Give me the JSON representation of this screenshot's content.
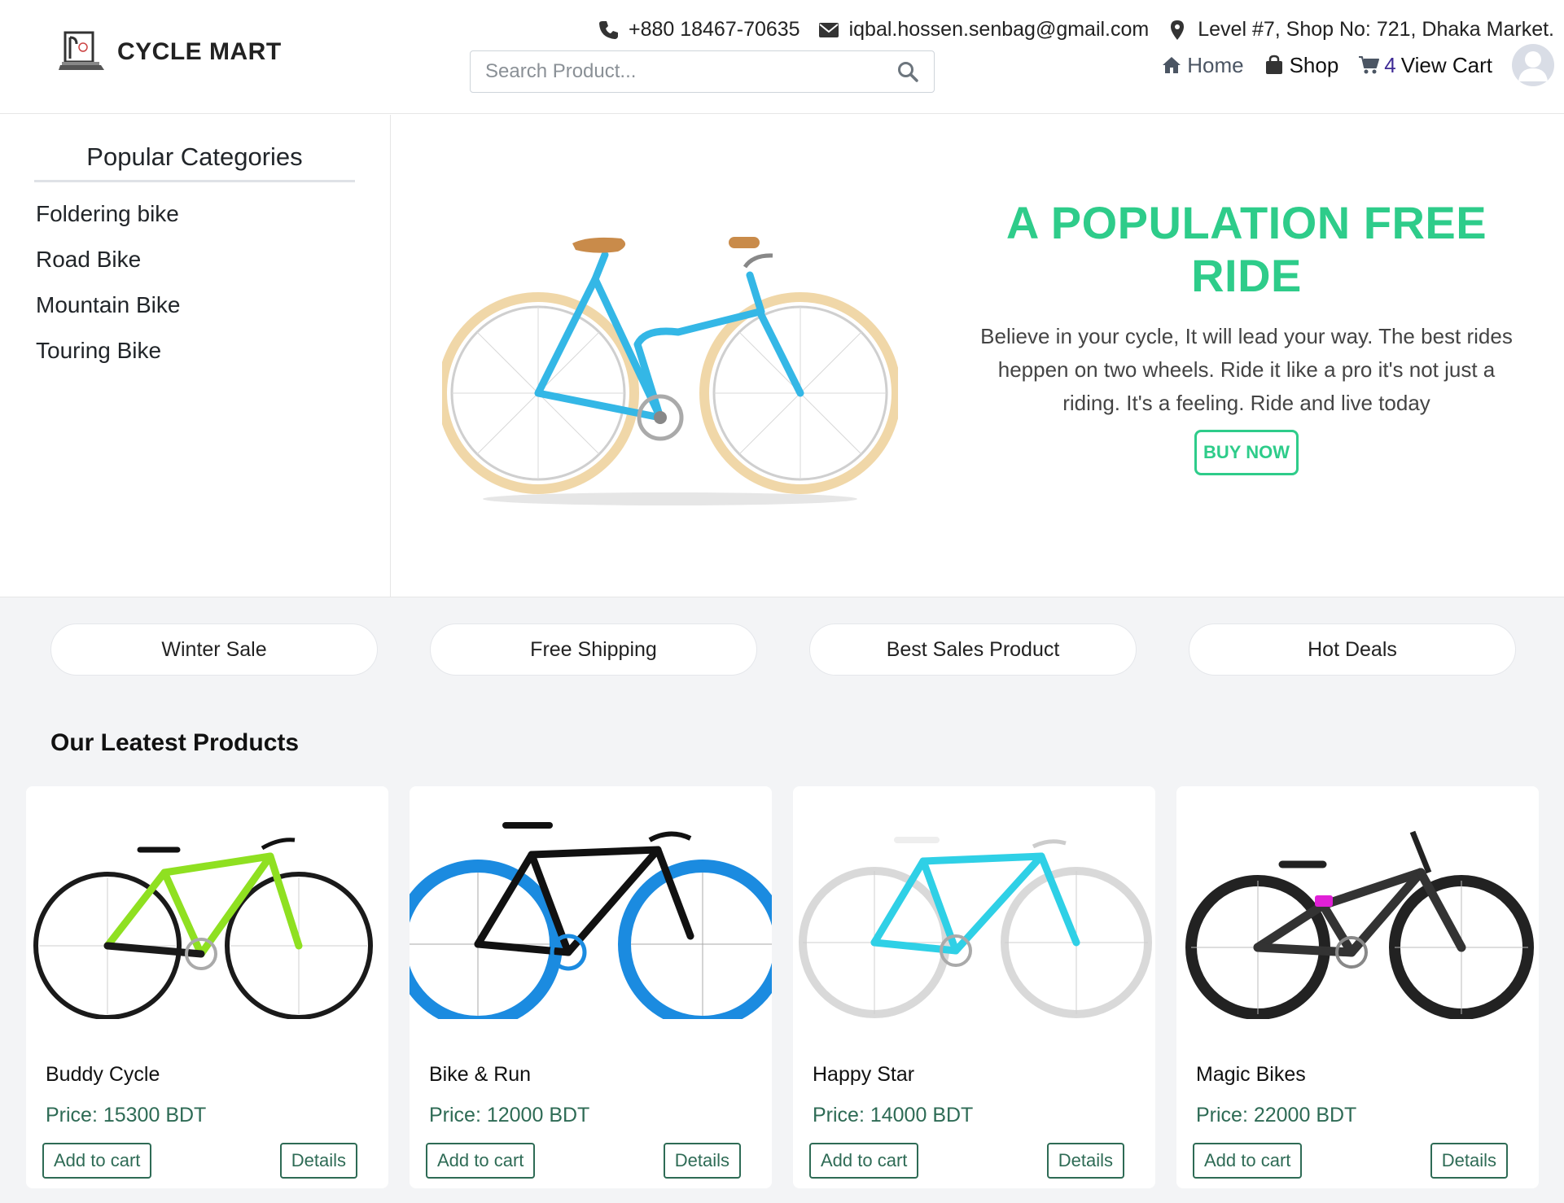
{
  "brand": {
    "name": "CYCLE MART"
  },
  "search": {
    "placeholder": "Search Product..."
  },
  "contact": {
    "phone": "+880 18467-70635",
    "email": "iqbal.hossen.senbag@gmail.com",
    "address": "Level #7, Shop No: 721, Dhaka Market."
  },
  "nav": {
    "home": "Home",
    "shop": "Shop",
    "cart_count": "4",
    "cart_label": "View Cart"
  },
  "sidebar": {
    "title": "Popular Categories",
    "items": [
      "Foldering bike",
      "Road Bike",
      "Mountain Bike",
      "Touring Bike"
    ]
  },
  "hero": {
    "title": "A POPULATION FREE RIDE",
    "description": "Believe in your cycle, It will lead your way. The best rides heppen on two wheels. Ride it like a pro it's not just a riding. It's a feeling. Ride and live today",
    "cta": "BUY NOW"
  },
  "promos": [
    "Winter Sale",
    "Free Shipping",
    "Best Sales Product",
    "Hot Deals"
  ],
  "products_section": {
    "title": "Our Leatest Products",
    "items": [
      {
        "name": "Buddy Cycle",
        "price": "Price: 15300 BDT",
        "add": "Add to cart",
        "details": "Details",
        "frame_color": "#8fe021",
        "wheel_color": "#1a1a1a"
      },
      {
        "name": "Bike & Run",
        "price": "Price: 12000 BDT",
        "add": "Add to cart",
        "details": "Details",
        "frame_color": "#111111",
        "wheel_color": "#1b8be0"
      },
      {
        "name": "Happy Star",
        "price": "Price: 14000 BDT",
        "add": "Add to cart",
        "details": "Details",
        "frame_color": "#2fd0e6",
        "wheel_color": "#dddddd"
      },
      {
        "name": "Magic Bikes",
        "price": "Price: 22000 BDT",
        "add": "Add to cart",
        "details": "Details",
        "frame_color": "#333333",
        "wheel_color": "#222222"
      }
    ]
  },
  "colors": {
    "accent_green": "#2ecc8a",
    "price_green": "#2e6b55",
    "hero_bike_frame": "#34b7e6",
    "hero_bike_tire": "#f0d7a8"
  },
  "icons": {
    "phone": "phone-icon",
    "email": "envelope-icon",
    "address": "map-marker-icon",
    "home": "home-icon",
    "shop": "shopping-bag-icon",
    "cart": "cart-icon",
    "search": "search-icon",
    "avatar": "user-avatar-icon"
  }
}
